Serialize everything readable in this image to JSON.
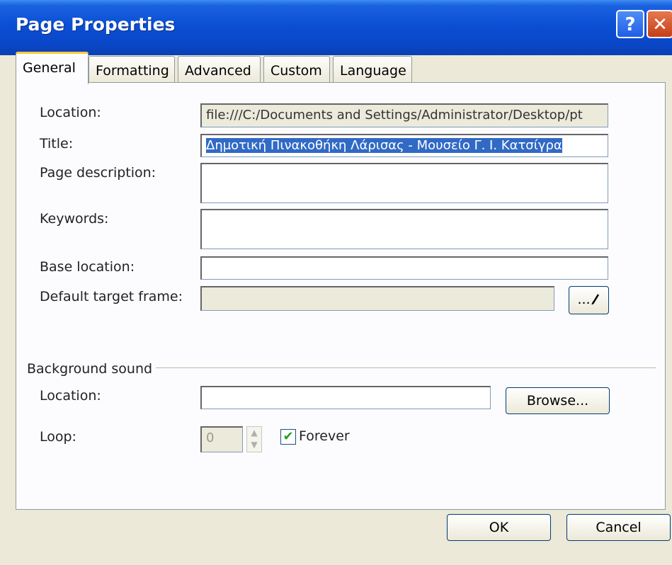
{
  "window": {
    "title": "Page Properties",
    "help_glyph": "?",
    "close_glyph": "✕"
  },
  "tabs": [
    {
      "label": "General",
      "active": true
    },
    {
      "label": "Formatting"
    },
    {
      "label": "Advanced"
    },
    {
      "label": "Custom"
    },
    {
      "label": "Language"
    }
  ],
  "general": {
    "location_label": "Location:",
    "location_value": "file:///C:/Documents and Settings/Administrator/Desktop/pt",
    "title_label": "Title:",
    "title_value": "Δημοτική Πινακοθήκη Λάρισας - Μουσείο Γ. Ι. Κατσίγρα",
    "description_label": "Page description:",
    "description_value": "",
    "keywords_label": "Keywords:",
    "keywords_value": "",
    "base_location_label": "Base location:",
    "base_location_value": "",
    "target_frame_label": "Default target frame:",
    "target_frame_value": "",
    "target_frame_button": "..."
  },
  "background_sound": {
    "group_label": "Background sound",
    "location_label": "Location:",
    "location_value": "",
    "browse_button": "Browse...",
    "loop_label": "Loop:",
    "loop_value": "0",
    "spin_up": "▲",
    "spin_down": "▼",
    "forever_label": "Forever",
    "forever_checked": true,
    "check_glyph": "✔"
  },
  "footer": {
    "ok_button": "OK",
    "cancel_button": "Cancel"
  }
}
